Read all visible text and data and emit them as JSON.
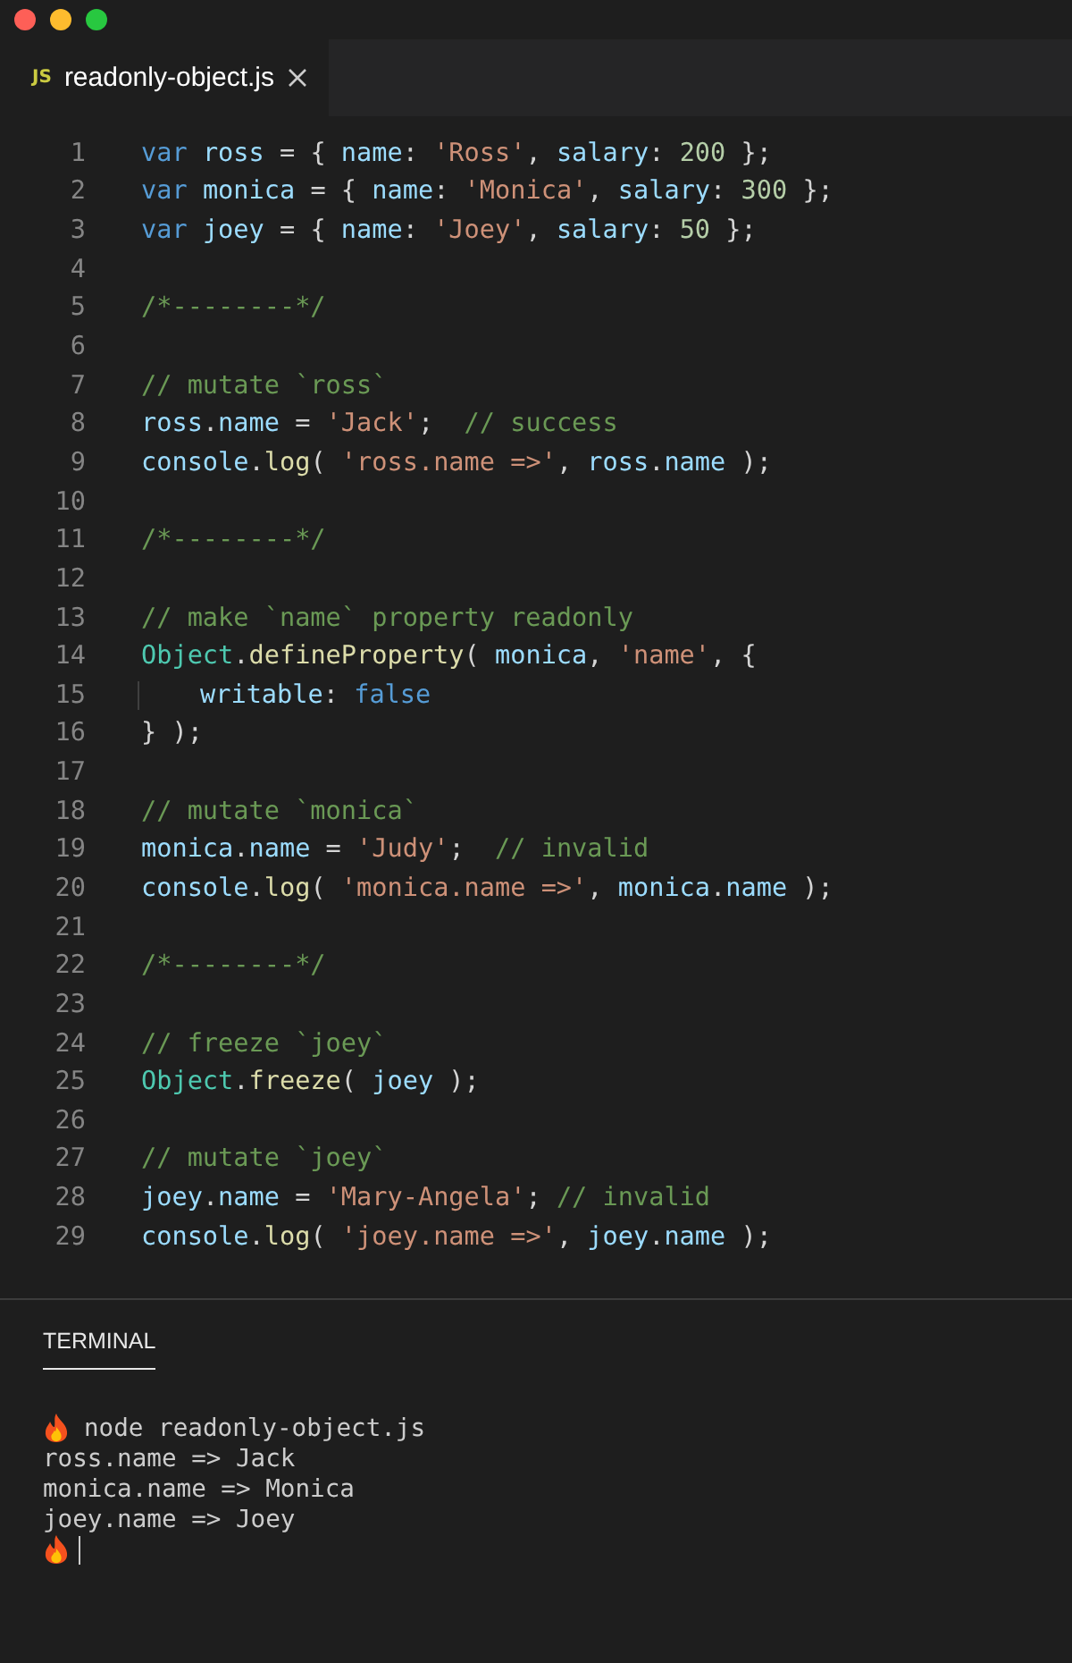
{
  "tab": {
    "badge": "JS",
    "title": "readonly-object.js"
  },
  "code": [
    {
      "number": "1",
      "tokens": [
        {
          "kind": "k",
          "text": "var "
        },
        {
          "kind": "v",
          "text": "ross"
        },
        {
          "kind": "p",
          "text": " = { "
        },
        {
          "kind": "v",
          "text": "name"
        },
        {
          "kind": "p",
          "text": ": "
        },
        {
          "kind": "s",
          "text": "'Ross'"
        },
        {
          "kind": "p",
          "text": ", "
        },
        {
          "kind": "v",
          "text": "salary"
        },
        {
          "kind": "p",
          "text": ": "
        },
        {
          "kind": "n",
          "text": "200"
        },
        {
          "kind": "p",
          "text": " };"
        }
      ]
    },
    {
      "number": "2",
      "tokens": [
        {
          "kind": "k",
          "text": "var "
        },
        {
          "kind": "v",
          "text": "monica"
        },
        {
          "kind": "p",
          "text": " = { "
        },
        {
          "kind": "v",
          "text": "name"
        },
        {
          "kind": "p",
          "text": ": "
        },
        {
          "kind": "s",
          "text": "'Monica'"
        },
        {
          "kind": "p",
          "text": ", "
        },
        {
          "kind": "v",
          "text": "salary"
        },
        {
          "kind": "p",
          "text": ": "
        },
        {
          "kind": "n",
          "text": "300"
        },
        {
          "kind": "p",
          "text": " };"
        }
      ]
    },
    {
      "number": "3",
      "tokens": [
        {
          "kind": "k",
          "text": "var "
        },
        {
          "kind": "v",
          "text": "joey"
        },
        {
          "kind": "p",
          "text": " = { "
        },
        {
          "kind": "v",
          "text": "name"
        },
        {
          "kind": "p",
          "text": ": "
        },
        {
          "kind": "s",
          "text": "'Joey'"
        },
        {
          "kind": "p",
          "text": ", "
        },
        {
          "kind": "v",
          "text": "salary"
        },
        {
          "kind": "p",
          "text": ": "
        },
        {
          "kind": "n",
          "text": "50"
        },
        {
          "kind": "p",
          "text": " };"
        }
      ]
    },
    {
      "number": "4"
    },
    {
      "number": "5",
      "tokens": [
        {
          "kind": "c",
          "text": "/*--------*/"
        }
      ]
    },
    {
      "number": "6"
    },
    {
      "number": "7",
      "tokens": [
        {
          "kind": "c",
          "text": "// mutate `ross`"
        }
      ]
    },
    {
      "number": "8",
      "tokens": [
        {
          "kind": "v",
          "text": "ross"
        },
        {
          "kind": "p",
          "text": "."
        },
        {
          "kind": "v",
          "text": "name"
        },
        {
          "kind": "p",
          "text": " = "
        },
        {
          "kind": "s",
          "text": "'Jack'"
        },
        {
          "kind": "p",
          "text": ";  "
        },
        {
          "kind": "c",
          "text": "// success"
        }
      ]
    },
    {
      "number": "9",
      "tokens": [
        {
          "kind": "v",
          "text": "console"
        },
        {
          "kind": "p",
          "text": "."
        },
        {
          "kind": "f",
          "text": "log"
        },
        {
          "kind": "p",
          "text": "( "
        },
        {
          "kind": "s",
          "text": "'ross.name =>'"
        },
        {
          "kind": "p",
          "text": ", "
        },
        {
          "kind": "v",
          "text": "ross"
        },
        {
          "kind": "p",
          "text": "."
        },
        {
          "kind": "v",
          "text": "name"
        },
        {
          "kind": "p",
          "text": " );"
        }
      ]
    },
    {
      "number": "10"
    },
    {
      "number": "11",
      "tokens": [
        {
          "kind": "c",
          "text": "/*--------*/"
        }
      ]
    },
    {
      "number": "12"
    },
    {
      "number": "13",
      "tokens": [
        {
          "kind": "c",
          "text": "// make `name` property readonly"
        }
      ]
    },
    {
      "number": "14",
      "tokens": [
        {
          "kind": "t",
          "text": "Object"
        },
        {
          "kind": "p",
          "text": "."
        },
        {
          "kind": "f",
          "text": "defineProperty"
        },
        {
          "kind": "p",
          "text": "( "
        },
        {
          "kind": "v",
          "text": "monica"
        },
        {
          "kind": "p",
          "text": ", "
        },
        {
          "kind": "s",
          "text": "'name'"
        },
        {
          "kind": "p",
          "text": ", {"
        }
      ]
    },
    {
      "number": "15",
      "indented": true,
      "tokens": [
        {
          "kind": "v",
          "text": "writable"
        },
        {
          "kind": "p",
          "text": ": "
        },
        {
          "kind": "k",
          "text": "false"
        }
      ]
    },
    {
      "number": "16",
      "tokens": [
        {
          "kind": "p",
          "text": "} );"
        }
      ]
    },
    {
      "number": "17"
    },
    {
      "number": "18",
      "tokens": [
        {
          "kind": "c",
          "text": "// mutate `monica`"
        }
      ]
    },
    {
      "number": "19",
      "tokens": [
        {
          "kind": "v",
          "text": "monica"
        },
        {
          "kind": "p",
          "text": "."
        },
        {
          "kind": "v",
          "text": "name"
        },
        {
          "kind": "p",
          "text": " = "
        },
        {
          "kind": "s",
          "text": "'Judy'"
        },
        {
          "kind": "p",
          "text": ";  "
        },
        {
          "kind": "c",
          "text": "// invalid"
        }
      ]
    },
    {
      "number": "20",
      "tokens": [
        {
          "kind": "v",
          "text": "console"
        },
        {
          "kind": "p",
          "text": "."
        },
        {
          "kind": "f",
          "text": "log"
        },
        {
          "kind": "p",
          "text": "( "
        },
        {
          "kind": "s",
          "text": "'monica.name =>'"
        },
        {
          "kind": "p",
          "text": ", "
        },
        {
          "kind": "v",
          "text": "monica"
        },
        {
          "kind": "p",
          "text": "."
        },
        {
          "kind": "v",
          "text": "name"
        },
        {
          "kind": "p",
          "text": " );"
        }
      ]
    },
    {
      "number": "21"
    },
    {
      "number": "22",
      "tokens": [
        {
          "kind": "c",
          "text": "/*--------*/"
        }
      ]
    },
    {
      "number": "23"
    },
    {
      "number": "24",
      "tokens": [
        {
          "kind": "c",
          "text": "// freeze `joey`"
        }
      ]
    },
    {
      "number": "25",
      "tokens": [
        {
          "kind": "t",
          "text": "Object"
        },
        {
          "kind": "p",
          "text": "."
        },
        {
          "kind": "f",
          "text": "freeze"
        },
        {
          "kind": "p",
          "text": "( "
        },
        {
          "kind": "v",
          "text": "joey"
        },
        {
          "kind": "p",
          "text": " );"
        }
      ]
    },
    {
      "number": "26"
    },
    {
      "number": "27",
      "tokens": [
        {
          "kind": "c",
          "text": "// mutate `joey`"
        }
      ]
    },
    {
      "number": "28",
      "tokens": [
        {
          "kind": "v",
          "text": "joey"
        },
        {
          "kind": "p",
          "text": "."
        },
        {
          "kind": "v",
          "text": "name"
        },
        {
          "kind": "p",
          "text": " = "
        },
        {
          "kind": "s",
          "text": "'Mary-Angela'"
        },
        {
          "kind": "p",
          "text": "; "
        },
        {
          "kind": "c",
          "text": "// invalid"
        }
      ]
    },
    {
      "number": "29",
      "tokens": [
        {
          "kind": "v",
          "text": "console"
        },
        {
          "kind": "p",
          "text": "."
        },
        {
          "kind": "f",
          "text": "log"
        },
        {
          "kind": "p",
          "text": "( "
        },
        {
          "kind": "s",
          "text": "'joey.name =>'"
        },
        {
          "kind": "p",
          "text": ", "
        },
        {
          "kind": "v",
          "text": "joey"
        },
        {
          "kind": "p",
          "text": "."
        },
        {
          "kind": "v",
          "text": "name"
        },
        {
          "kind": "p",
          "text": " );"
        }
      ]
    }
  ],
  "terminal": {
    "title": "TERMINAL",
    "lines": [
      {
        "kind": "prompt",
        "text": "node readonly-object.js"
      },
      {
        "kind": "output",
        "text": "ross.name => Jack"
      },
      {
        "kind": "output",
        "text": "monica.name => Monica"
      },
      {
        "kind": "output",
        "text": "joey.name => Joey"
      },
      {
        "kind": "cursor"
      }
    ]
  }
}
